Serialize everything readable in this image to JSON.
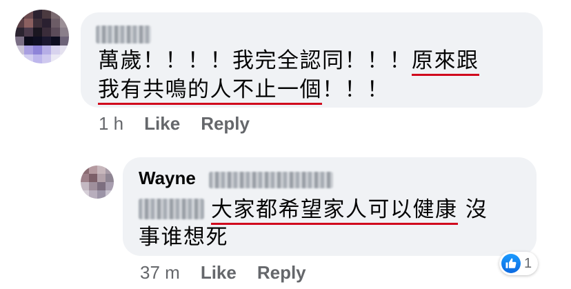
{
  "comment": {
    "text_line1_plain": "萬歲！！！！我完全認同！！！",
    "text_line1_underlined": "原來跟",
    "text_line2_underlined": "我有共鳴的人不止一個",
    "text_line2_plain": "！！！",
    "timestamp": "1 h",
    "like_label": "Like",
    "reply_label": "Reply"
  },
  "reply": {
    "author_first_name": "Wayne",
    "text_underlined": "大家都希望家人可以健康",
    "text_line1_plain": " 沒",
    "text_line2": "事谁想死",
    "timestamp": "37 m",
    "like_label": "Like",
    "reply_label": "Reply",
    "reaction": {
      "icon": "thumbs-up-icon",
      "count": "1",
      "color": "#1877f2"
    }
  },
  "colors": {
    "bubble": "#f0f2f5",
    "underline": "#d0021b",
    "meta_text": "#65676b"
  }
}
